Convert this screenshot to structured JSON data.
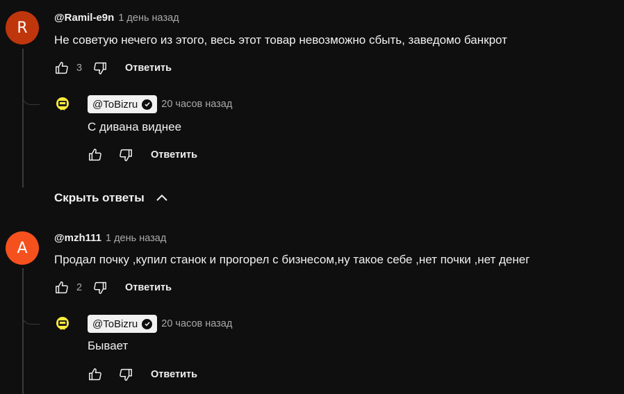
{
  "comments": [
    {
      "avatar_letter": "R",
      "avatar_color": "#bf360c",
      "handle": "@Ramil-e9n",
      "time": "1 день назад",
      "text": "Не советую нечего из этого, весь этот товар невозможно сбыть, заведомо банкрот",
      "likes": "3",
      "reply_label": "Ответить",
      "reply": {
        "handle": "@ToBizru",
        "time": "20 часов назад",
        "text": "С дивана виднее",
        "reply_label": "Ответить"
      }
    },
    {
      "avatar_letter": "A",
      "avatar_color": "#f4511e",
      "handle": "@mzh111",
      "time": "1 день назад",
      "text": "Продал почку ,купил станок и прогорел с бизнесом,ну такое себе ,нет почки ,нет денег",
      "likes": "2",
      "reply_label": "Ответить",
      "reply": {
        "handle": "@ToBizru",
        "time": "20 часов назад",
        "text": "Бывает",
        "reply_label": "Ответить"
      }
    }
  ],
  "hide_replies_label": "Скрыть ответы",
  "channel_avatar_color": "#ffeb3b"
}
